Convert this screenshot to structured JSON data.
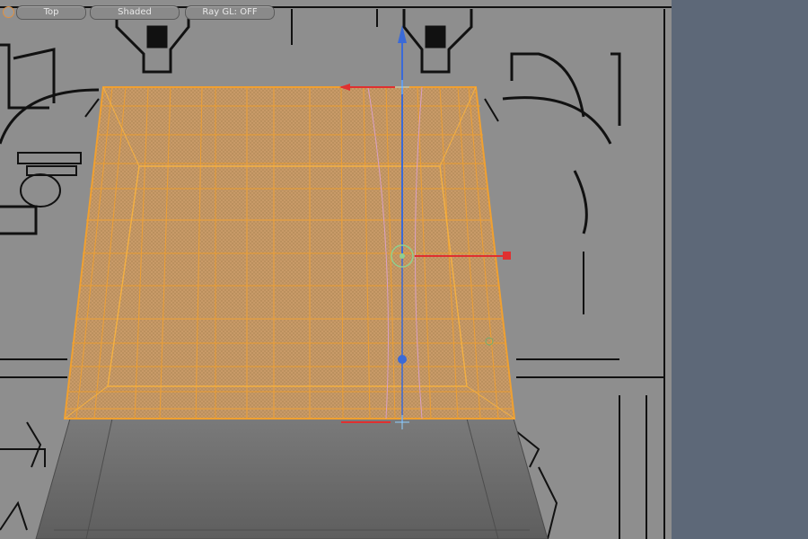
{
  "viewport": {
    "view_label": "Top",
    "shading_label": "Shaded",
    "raygl_label": "Ray GL: OFF"
  },
  "icons": {
    "viewport_menu": "viewport-menu-icon",
    "transform_gizmo": "transform-gizmo-icon"
  },
  "colors": {
    "selection_wire": "#f0a030",
    "selection_fill": "#c09a6a",
    "axis_x": "#e03030",
    "axis_y": "#3a6ad8",
    "pivot": "#8fd08f",
    "viewport_bg": "#8e8e8e",
    "panel_bg": "#5d6878"
  }
}
